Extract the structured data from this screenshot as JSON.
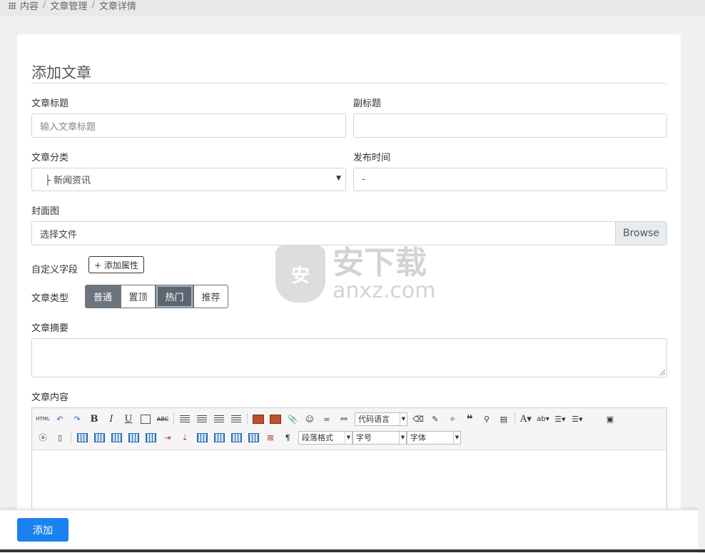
{
  "breadcrumb": {
    "items": [
      "内容",
      "文章管理",
      "文章详情"
    ],
    "separator": "/"
  },
  "form": {
    "heading": "添加文章",
    "title": {
      "label": "文章标题",
      "placeholder": "输入文章标题"
    },
    "subtitle": {
      "label": "副标题",
      "value": ""
    },
    "category": {
      "label": "文章分类",
      "value": "├ 新闻资讯"
    },
    "publish_time": {
      "label": "发布时间",
      "value": "-"
    },
    "cover": {
      "label": "封面图",
      "placeholder": "选择文件",
      "browse_label": "Browse"
    },
    "custom_fields": {
      "label": "自定义字段",
      "add_button": "+ 添加属性"
    },
    "article_type": {
      "label": "文章类型",
      "options": [
        "普通",
        "置顶",
        "热门",
        "推荐"
      ],
      "selected": [
        "普通",
        "热门"
      ]
    },
    "summary": {
      "label": "文章摘要",
      "value": ""
    },
    "content": {
      "label": "文章内容"
    }
  },
  "editor_toolbar": {
    "code_language": "代码语言",
    "paragraph_format": "段落格式",
    "font_size": "字号",
    "font_family": "字体",
    "html_label": "HTML"
  },
  "footer": {
    "submit_label": "添加"
  },
  "watermark": {
    "cn": "安下载",
    "en": "anxz.com"
  },
  "colors": {
    "primary": "#1a82f0",
    "secondary": "#6c757d"
  }
}
